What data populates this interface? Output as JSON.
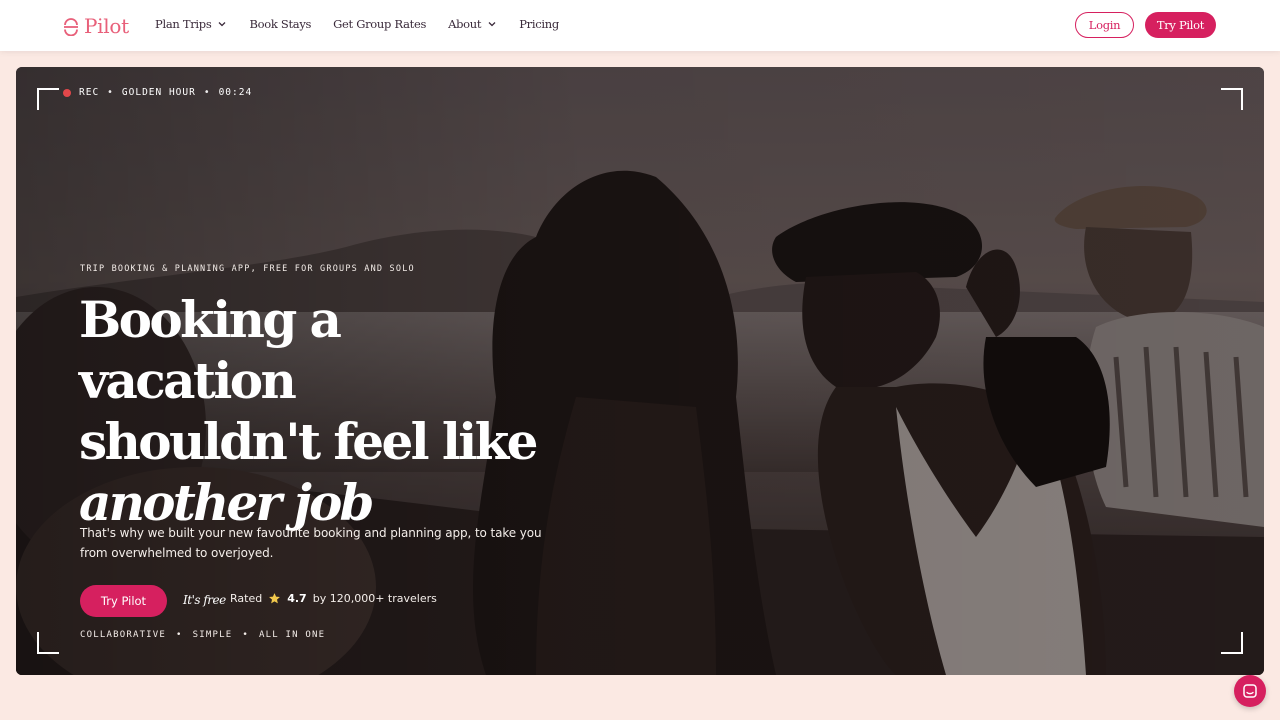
{
  "nav": {
    "logo_text": "Pilot",
    "links": [
      {
        "label": "Plan Trips",
        "has_dropdown": true
      },
      {
        "label": "Book Stays",
        "has_dropdown": false
      },
      {
        "label": "Get Group Rates",
        "has_dropdown": false
      },
      {
        "label": "About",
        "has_dropdown": true
      },
      {
        "label": "Pricing",
        "has_dropdown": false
      }
    ],
    "login_label": "Login",
    "try_label": "Try Pilot"
  },
  "hero": {
    "rec": {
      "status": "REC",
      "mode": "GOLDEN HOUR",
      "time": "00:24",
      "separator": "•"
    },
    "eyebrow": "TRIP BOOKING & PLANNING APP, FREE FOR GROUPS AND SOLO",
    "headline": {
      "line1": "Booking a vacation",
      "line2": "shouldn't feel like",
      "line3": "another job"
    },
    "subtext": "That's why we built your new favourite booking and planning app, to take you from overwhelmed to overjoyed.",
    "cta_label": "Try Pilot",
    "free_label": "It's free",
    "rating": {
      "prefix": "Rated",
      "score": "4.7",
      "suffix": "by 120,000+ travelers"
    },
    "tags": [
      "COLLABORATIVE",
      "•",
      "SIMPLE",
      "•",
      "ALL IN ONE"
    ]
  },
  "colors": {
    "brand": "#d6205f",
    "logo": "#e8607a",
    "rec_dot": "#e2474a",
    "page_bg": "#fbe9e3"
  },
  "icons": {
    "chat": "chat-icon",
    "star": "star-icon",
    "dropdown": "chevron-down-icon"
  }
}
